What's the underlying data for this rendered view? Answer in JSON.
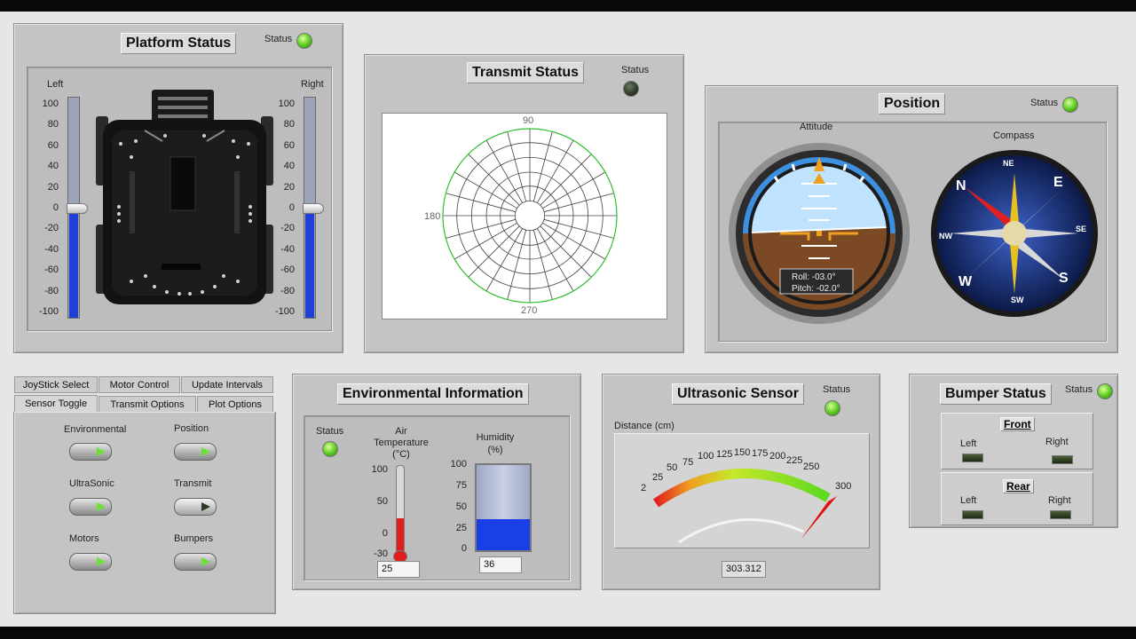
{
  "platform": {
    "title": "Platform Status",
    "status_label": "Status",
    "left_label": "Left",
    "right_label": "Right",
    "scale": [
      "100",
      "80",
      "60",
      "40",
      "20",
      "0",
      "-20",
      "-40",
      "-60",
      "-80",
      "-100"
    ],
    "left_value": 0,
    "right_value": 0
  },
  "transmit": {
    "title": "Transmit Status",
    "status_label": "Status",
    "angle_90": "90",
    "angle_180": "180",
    "angle_270": "270"
  },
  "position": {
    "title": "Position",
    "status_label": "Status",
    "attitude_label": "Attitude",
    "compass_label": "Compass",
    "roll_text": "Roll:   -03.0°",
    "pitch_text": "Pitch: -02.0°",
    "compass_dirs": {
      "n": "N",
      "ne": "NE",
      "e": "E",
      "se": "SE",
      "s": "S",
      "sw": "SW",
      "w": "W",
      "nw": "NW"
    }
  },
  "tabs": {
    "row1": [
      "JoyStick Select",
      "Motor Control",
      "Update Intervals"
    ],
    "row2": [
      "Sensor Toggle",
      "Transmit Options",
      "Plot Options"
    ],
    "active": "Sensor Toggle",
    "toggles": [
      {
        "label": "Environmental",
        "on": true
      },
      {
        "label": "Position",
        "on": true
      },
      {
        "label": "UltraSonic",
        "on": true
      },
      {
        "label": "Transmit",
        "on": false
      },
      {
        "label": "Motors",
        "on": true
      },
      {
        "label": "Bumpers",
        "on": true
      }
    ]
  },
  "environment": {
    "title": "Environmental Information",
    "status_label": "Status",
    "temp_label": "Air Temperature (°C)",
    "temp_ticks": [
      "100",
      "50",
      "0",
      "-30"
    ],
    "temp_value": "25",
    "humidity_label": "Humidity (%)",
    "hum_ticks": [
      "100",
      "75",
      "50",
      "25",
      "0"
    ],
    "hum_value": "36"
  },
  "ultrasonic": {
    "title": "Ultrasonic Sensor",
    "status_label": "Status",
    "distance_label": "Distance (cm)",
    "gauge_ticks": [
      "2",
      "25",
      "50",
      "75",
      "100",
      "125",
      "150",
      "175",
      "200",
      "225",
      "250",
      "300"
    ],
    "gauge_min": 2,
    "gauge_max": 300,
    "value": "303.312"
  },
  "bumper": {
    "title": "Bumper Status",
    "status_label": "Status",
    "front_label": "Front",
    "rear_label": "Rear",
    "left_label": "Left",
    "right_label": "Right"
  },
  "colors": {
    "led_on": "#59c81f",
    "led_off": "#2c3526",
    "slider_fill": "#1f3fd6",
    "thermo_fill": "#e01c1c",
    "humidity_fill": "#1a3fe6",
    "sky": "#3d8fe0",
    "ground": "#7b4a25"
  }
}
